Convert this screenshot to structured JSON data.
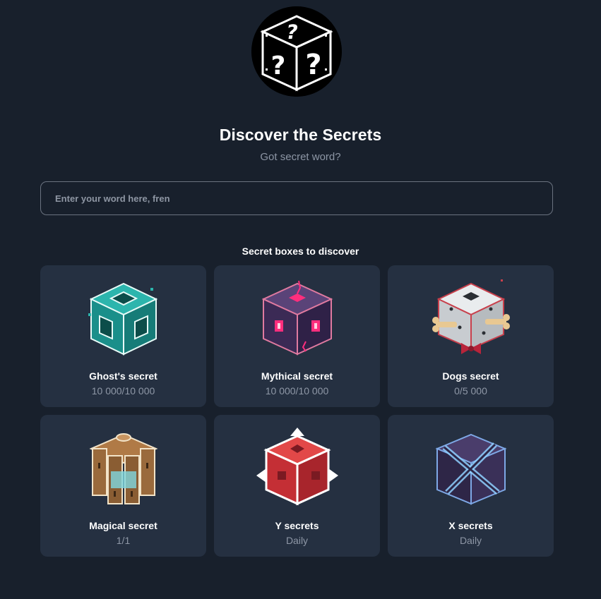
{
  "header": {
    "title": "Discover the Secrets",
    "subtitle": "Got secret word?"
  },
  "search": {
    "placeholder": "Enter your word here, fren",
    "value": ""
  },
  "section": {
    "title": "Secret boxes to discover"
  },
  "boxes": [
    {
      "name": "Ghost's secret",
      "count": "10 000/10 000",
      "icon": "teal-cube-icon",
      "color": "#1f9e9a"
    },
    {
      "name": "Mythical secret",
      "count": "10 000/10 000",
      "icon": "purple-crystal-cube-icon",
      "color": "#4a3566"
    },
    {
      "name": "Dogs secret",
      "count": "0/5 000",
      "icon": "bone-cube-icon",
      "color": "#d8dcdf"
    },
    {
      "name": "Magical secret",
      "count": "1/1",
      "icon": "wooden-pillars-cube-icon",
      "color": "#9a6a3c"
    },
    {
      "name": "Y secrets",
      "count": "Daily",
      "icon": "red-arrows-cube-icon",
      "color": "#d63a3a"
    },
    {
      "name": "X secrets",
      "count": "Daily",
      "icon": "x-cube-icon",
      "color": "#3d3258"
    }
  ]
}
